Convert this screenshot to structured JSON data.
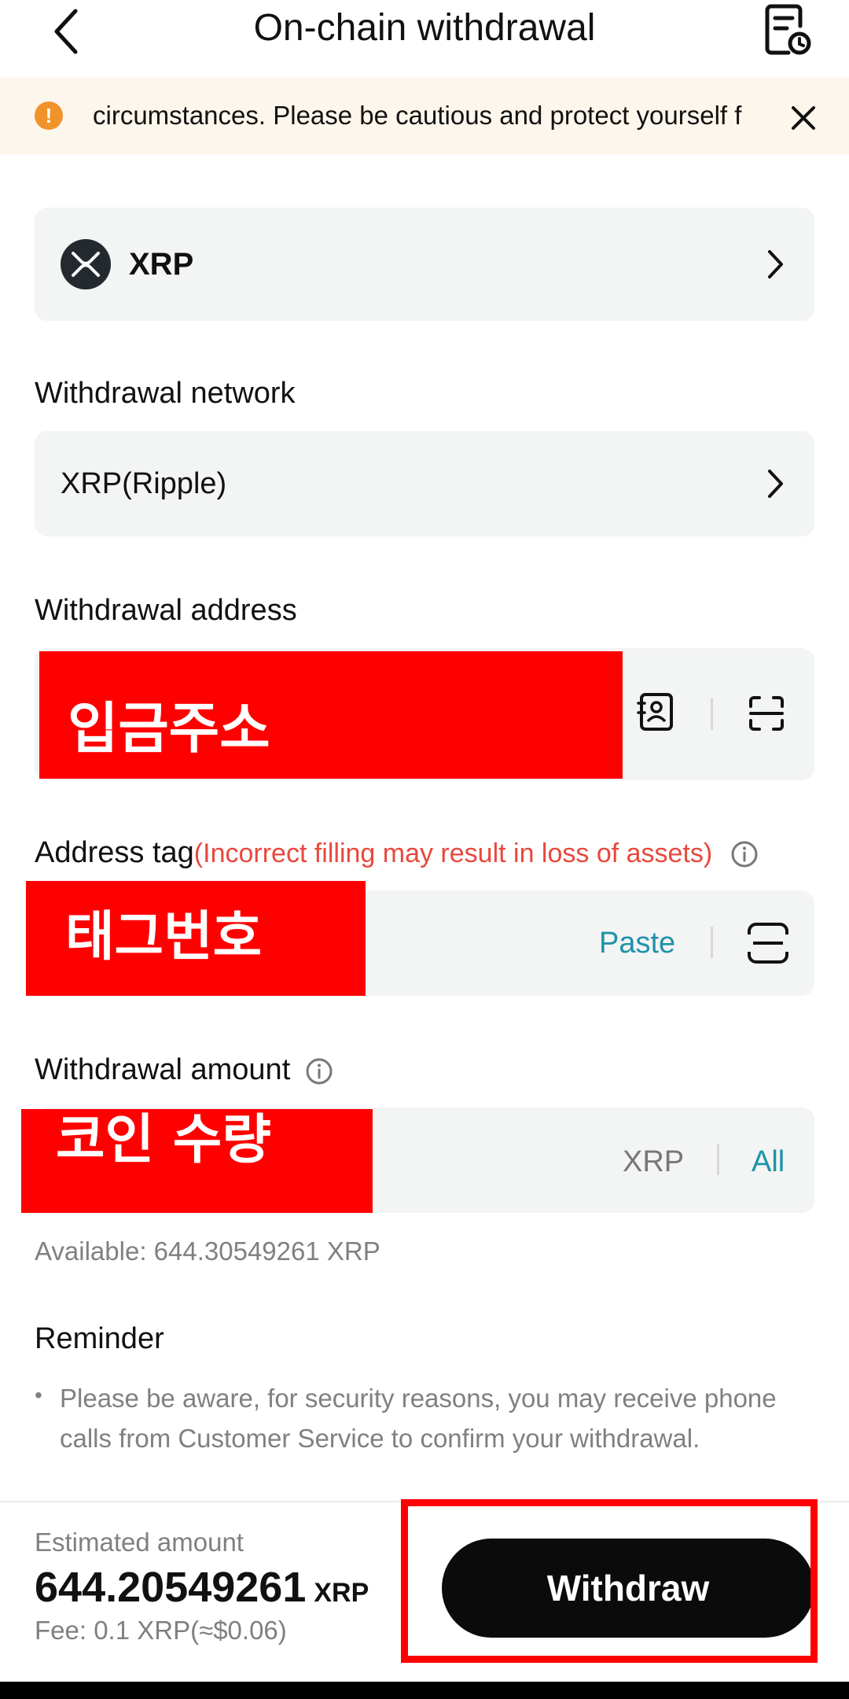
{
  "header": {
    "title": "On-chain withdrawal",
    "back_icon": "chevron-left-icon",
    "history_icon": "document-clock-icon"
  },
  "banner": {
    "text": "circumstances. Please be cautious and protect yourself f",
    "icon": "warning-icon",
    "warning_color": "#f0932b"
  },
  "coin": {
    "name": "XRP",
    "icon": "xrp-logo"
  },
  "network": {
    "label": "Withdrawal network",
    "value": "XRP(Ripple)"
  },
  "address": {
    "label": "Withdrawal address",
    "overlay_text": "입금주소"
  },
  "tag": {
    "label": "Address tag",
    "warning": "(Incorrect filling may result in loss of assets)",
    "overlay_text": "태그번호",
    "paste_label": "Paste"
  },
  "amount": {
    "label": "Withdrawal amount",
    "overlay_text": "코인 수량",
    "unit": "XRP",
    "all_label": "All"
  },
  "available": "Available: 644.30549261 XRP",
  "reminder": {
    "title": "Reminder",
    "items": [
      "Please be aware, for security reasons, you may receive phone calls from Customer Service to confirm your withdrawal."
    ]
  },
  "footer": {
    "estimated_label": "Estimated amount",
    "estimated_value": "644.20549261",
    "estimated_unit": "XRP",
    "fee": "Fee: 0.1 XRP(≈$0.06)",
    "withdraw_label": "Withdraw"
  },
  "colors": {
    "accent_teal": "#1e93a8",
    "warning_red": "#e8483c",
    "annotation_red": "#ff0000",
    "button_black": "#0b0b0b"
  }
}
